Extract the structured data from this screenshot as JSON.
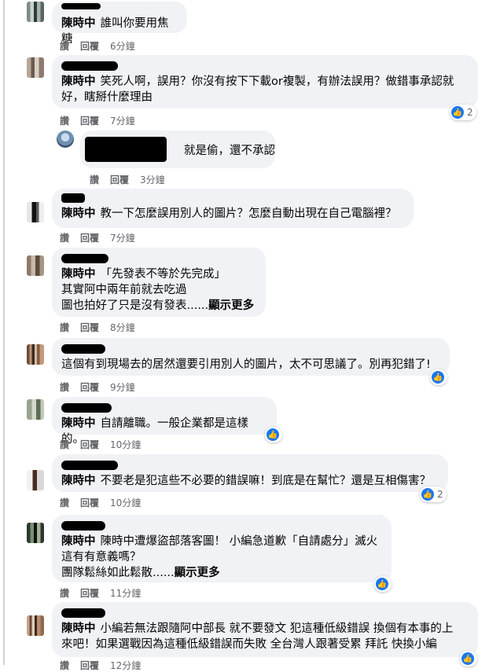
{
  "mention_name": "陳時中",
  "actions": {
    "like": "讚",
    "reply": "回覆"
  },
  "comments": [
    {
      "text": "誰叫你要用焦糖",
      "time": "6分鐘"
    },
    {
      "text": "笑死人啊，誤用？你沒有按下下載or複製，有辦法誤用？做錯事承認就\n好，瞎掰什麼理由",
      "time": "7分鐘",
      "reactions": "2"
    },
    {
      "text": "就是偷，還不承認",
      "time": "3分鐘"
    },
    {
      "text": "教一下怎麼誤用別人的圖片？怎麼自動出現在自己電腦裡？",
      "time": "7分鐘"
    },
    {
      "text": "「先發表不等於先完成」\n其實阿中兩年前就去吃過\n圖也拍好了只是沒有發表......",
      "more": "顯示更多",
      "time": "8分鐘"
    },
    {
      "text": "這個有到現場去的居然還要引用別人的圖片，太不可思議了。別再犯錯了!",
      "time": "9分鐘"
    },
    {
      "text": "自請離職。一般企業都是這樣的。",
      "time": "10分鐘"
    },
    {
      "text": "不要老是犯這些不必要的錯誤嘛！到底是在幫忙？還是互相傷害？",
      "time": "10分鐘",
      "reactions": "2"
    },
    {
      "text": "陳時中遭爆盜部落客圖！ 小編急道歉「自請處分」滅火\n這有有意義嗎？\n團隊鬆絲如此鬆散......",
      "more": "顯示更多",
      "time": "11分鐘"
    },
    {
      "text": "小編若無法跟隨阿中部長 就不要發文 犯這種低級錯誤 換個有本事的上\n來吧！如果選戰因為這種低級錯誤而失敗 全台灣人跟著受累 拜託 快換小編",
      "time": "12分鐘"
    }
  ],
  "icons": {
    "like": "thumbs-up-icon"
  },
  "colors": {
    "bubble": "#f0f2f5",
    "like": "#1877f2",
    "meta": "#65676b"
  }
}
